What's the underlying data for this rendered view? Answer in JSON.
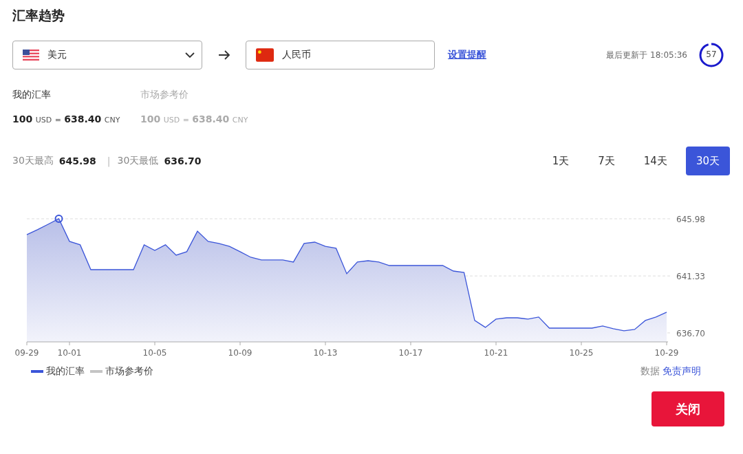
{
  "title": "汇率趋势",
  "from_currency": {
    "name": "美元"
  },
  "to_currency": {
    "name": "人民币"
  },
  "alert_link": "设置提醒",
  "updated": "最后更新于 18:05:36",
  "countdown": {
    "value": "57",
    "level": 0.95
  },
  "my_rate": {
    "label": "我的汇率",
    "amount": "100",
    "from": "USD",
    "equals": "=",
    "result": "638.40",
    "to": "CNY"
  },
  "market_rate": {
    "label": "市场参考价",
    "amount": "100",
    "from": "USD",
    "equals": "=",
    "result": "638.40",
    "to": "CNY"
  },
  "stats": {
    "high_label": "30天最高",
    "high": "645.98",
    "separator": "|",
    "low_label": "30天最低",
    "low": "636.70"
  },
  "ranges": [
    {
      "label": "1天",
      "selected": false
    },
    {
      "label": "7天",
      "selected": false
    },
    {
      "label": "14天",
      "selected": false
    },
    {
      "label": "30天",
      "selected": true
    }
  ],
  "chart": {
    "chart_data": {
      "type": "area",
      "categories": [
        "09-29",
        null,
        null,
        null,
        "10-01",
        null,
        null,
        null,
        null,
        null,
        null,
        null,
        "10-05",
        null,
        null,
        null,
        null,
        null,
        null,
        null,
        "10-09",
        null,
        null,
        null,
        null,
        null,
        null,
        null,
        "10-13",
        null,
        null,
        null,
        null,
        null,
        null,
        null,
        "10-17",
        null,
        null,
        null,
        null,
        null,
        null,
        null,
        "10-21",
        null,
        null,
        null,
        null,
        null,
        null,
        null,
        "10-25",
        null,
        null,
        null,
        null,
        null,
        null,
        null,
        "10-29"
      ],
      "series": [
        {
          "name": "我的汇率",
          "color": "#3b55d9",
          "values": [
            644.69,
            645.09,
            645.53,
            645.98,
            644.14,
            643.86,
            641.84,
            641.84,
            641.84,
            641.84,
            641.84,
            643.86,
            643.41,
            643.86,
            643.02,
            643.3,
            644.97,
            644.14,
            643.97,
            643.74,
            643.3,
            642.85,
            642.63,
            642.63,
            642.63,
            642.46,
            643.97,
            644.08,
            643.74,
            643.58,
            641.51,
            642.46,
            642.57,
            642.46,
            642.18,
            642.18,
            642.18,
            642.18,
            642.18,
            642.18,
            641.73,
            641.62,
            637.71,
            637.15,
            637.82,
            637.93,
            637.93,
            637.82,
            637.99,
            637.09,
            637.09,
            637.09,
            637.09,
            637.09,
            637.26,
            637.04,
            636.87,
            636.98,
            637.71,
            637.99,
            638.38
          ]
        }
      ],
      "yticks": [
        {
          "value": 645.98,
          "label": "645.98"
        },
        {
          "value": 641.33,
          "label": "641.33"
        },
        {
          "value": 636.7,
          "label": "636.70"
        }
      ],
      "ylim": [
        635.97,
        645.98
      ],
      "grid": true
    }
  },
  "legend": [
    {
      "label": "市场参考价",
      "color": "#c4c4c4"
    }
  ],
  "footer": {
    "prefix": "数据",
    "link": "免责声明"
  },
  "close_button": "关闭"
}
